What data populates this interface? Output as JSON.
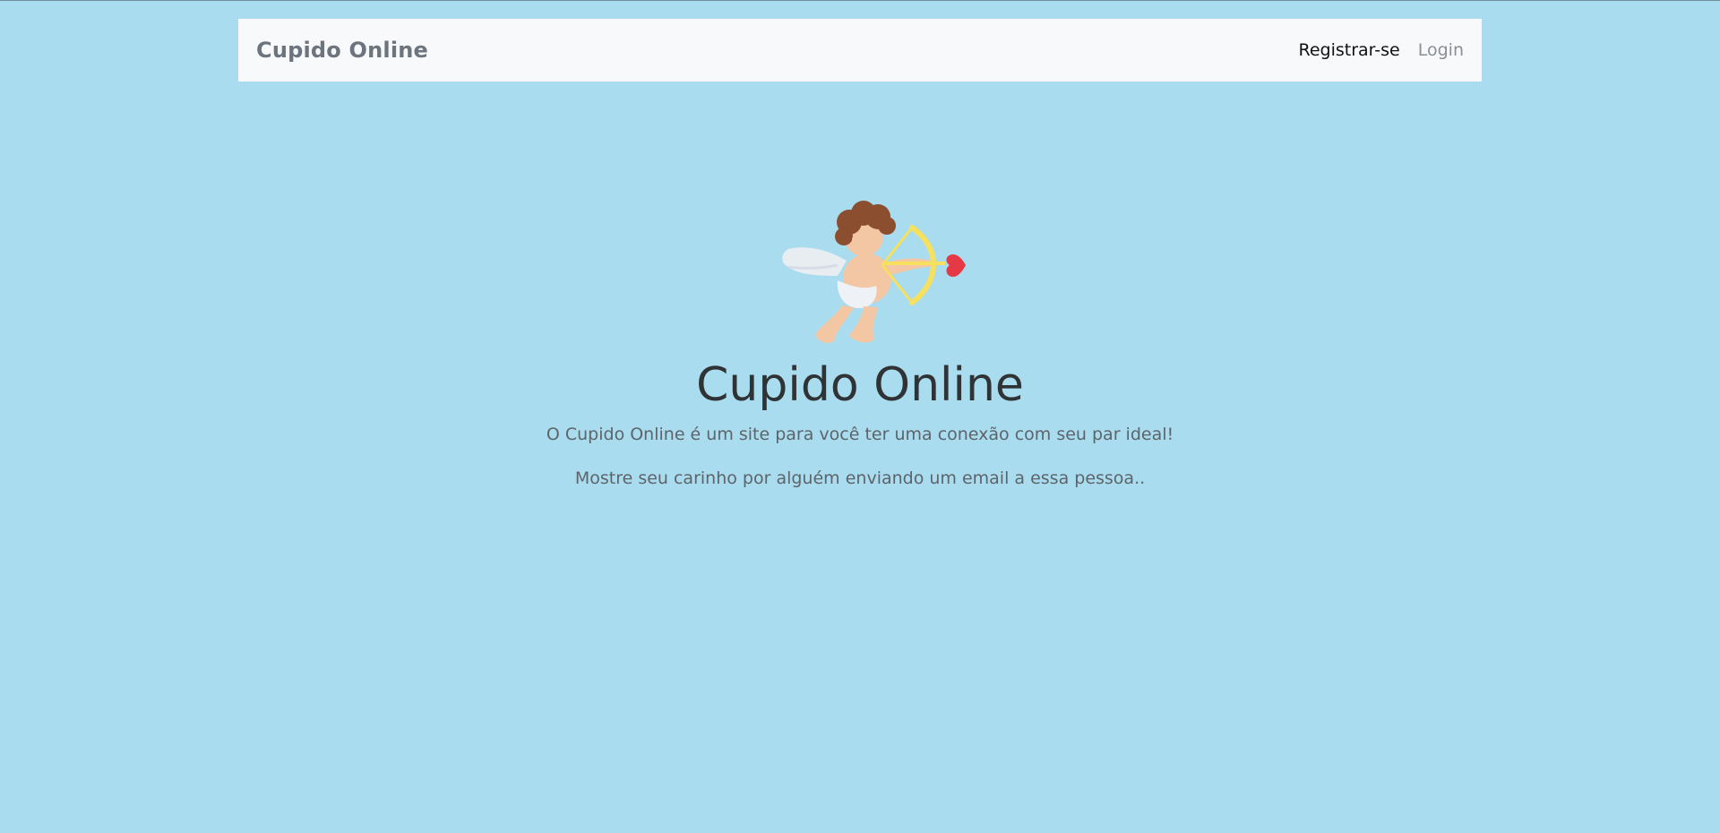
{
  "navbar": {
    "brand": "Cupido Online",
    "links": [
      {
        "label": "Registrar-se",
        "active": true
      },
      {
        "label": "Login",
        "active": false
      }
    ]
  },
  "hero": {
    "illustration": "cupid-icon",
    "title": "Cupido Online",
    "paragraphs": [
      "O Cupido Online é um site para você ter uma conexão com seu par ideal!",
      "Mostre seu carinho por alguém enviando um email a essa pessoa.."
    ]
  },
  "colors": {
    "background": "#a8dcee",
    "navbar": "#f7f9fb",
    "heart": "#e63946",
    "bow": "#f6e05e"
  }
}
